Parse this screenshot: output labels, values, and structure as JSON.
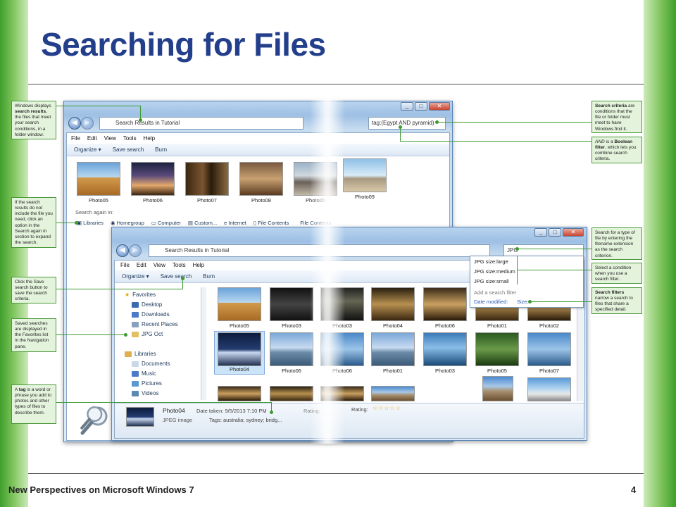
{
  "slide": {
    "title": "Searching for Files",
    "footer": "New Perspectives on Microsoft Windows 7",
    "page_number": "4"
  },
  "callouts_left": [
    {
      "pre": "Windows displays ",
      "bold": "search results",
      "post": ", the files that meet your search conditions, in a folder window."
    },
    {
      "text": "If the search results do not include the file you need, click an option in the Search again in section to expand the search."
    },
    {
      "text": "Click the Save search button to save the search criteria."
    },
    {
      "text": "Saved searches are displayed in the Favorites list in the Navigation pane."
    },
    {
      "pre": "A ",
      "bold": "tag",
      "post": " is a word or phrase you add to photos and other types of files to describe them."
    }
  ],
  "callouts_right": [
    {
      "bold": "Search criteria",
      "post": " are conditions that the file or folder must meet to have Windows find it."
    },
    {
      "italic": "AND",
      "pre2": " is a ",
      "bold": "Boolean filter",
      "post": ", which lets you combine search criteria."
    },
    {
      "text": "Search for a type of file by entering the filename extension as the search criterion."
    },
    {
      "text": "Select a condition when you use a search filter."
    },
    {
      "bold": "Search filters",
      "post": " narrow a search to files that share a specified detail."
    }
  ],
  "window1": {
    "address": "Search Results in Tutorial",
    "search_query": "tag:(Egypt AND pyramid)",
    "menu": [
      "File",
      "Edit",
      "View",
      "Tools",
      "Help"
    ],
    "toolbar": [
      "Organize ▾",
      "Save search",
      "Burn"
    ],
    "photos": [
      "Photo05",
      "Photo06",
      "Photo07",
      "Photo08",
      "Photo05",
      "Photo09"
    ],
    "search_again_label": "Search again in:",
    "search_again": [
      "Libraries",
      "Homegroup",
      "Computer",
      "Custom...",
      "Internet",
      "File Contents",
      "File Contents"
    ]
  },
  "window2": {
    "address": "Search Results in Tutorial",
    "search_query": "JPG",
    "menu": [
      "File",
      "Edit",
      "View",
      "Tools",
      "Help"
    ],
    "toolbar": [
      "Organize ▾",
      "Save search",
      "Burn"
    ],
    "nav": [
      "Favorites",
      "Desktop",
      "Downloads",
      "Recent Places",
      "JPG Oct",
      "Libraries",
      "Documents",
      "Music",
      "Pictures",
      "Videos"
    ],
    "dropdown": [
      "JPG size:large",
      "JPG size:medium",
      "JPG size:small",
      "Add a search filter",
      "Date modified:",
      "Size:"
    ],
    "row1": [
      "Photo05",
      "Photo03",
      "Photo03",
      "Photo04",
      "Photo06",
      "Photo01",
      "Photo02"
    ],
    "row2": [
      "Photo04",
      "Photo06",
      "Photo06",
      "Photo01",
      "Photo03",
      "Photo05",
      "Photo07"
    ],
    "details": {
      "name": "Photo04",
      "type": "JPEG image",
      "date_taken": "Date taken: 9/5/2013 7:10 PM",
      "tags": "Tags: australia; sydney; bridg...",
      "rating_label": "Rating:",
      "rating_label_faded": "Rating:",
      "tags_faded": "...",
      "stars": "☆☆☆☆☆"
    }
  }
}
